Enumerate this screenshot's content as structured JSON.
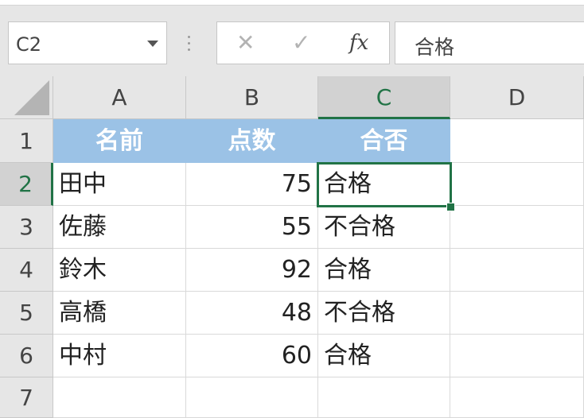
{
  "name_box": {
    "value": "C2",
    "dropdown_icon": "chevron-down-icon"
  },
  "formula_bar": {
    "cancel_icon": "✕",
    "enter_icon": "✓",
    "fx_label": "fx",
    "content": "合格"
  },
  "columns": [
    "A",
    "B",
    "C",
    "D"
  ],
  "rows": [
    "1",
    "2",
    "3",
    "4",
    "5",
    "6",
    "7"
  ],
  "table": {
    "headers": [
      "名前",
      "点数",
      "合否"
    ],
    "data": [
      [
        "田中",
        "75",
        "合格"
      ],
      [
        "佐藤",
        "55",
        "不合格"
      ],
      [
        "鈴木",
        "92",
        "合格"
      ],
      [
        "高橋",
        "48",
        "不合格"
      ],
      [
        "中村",
        "60",
        "合格"
      ]
    ]
  },
  "selection": {
    "cell": "C2"
  },
  "colors": {
    "accent": "#217346",
    "header_fill": "#9bc2e6"
  }
}
